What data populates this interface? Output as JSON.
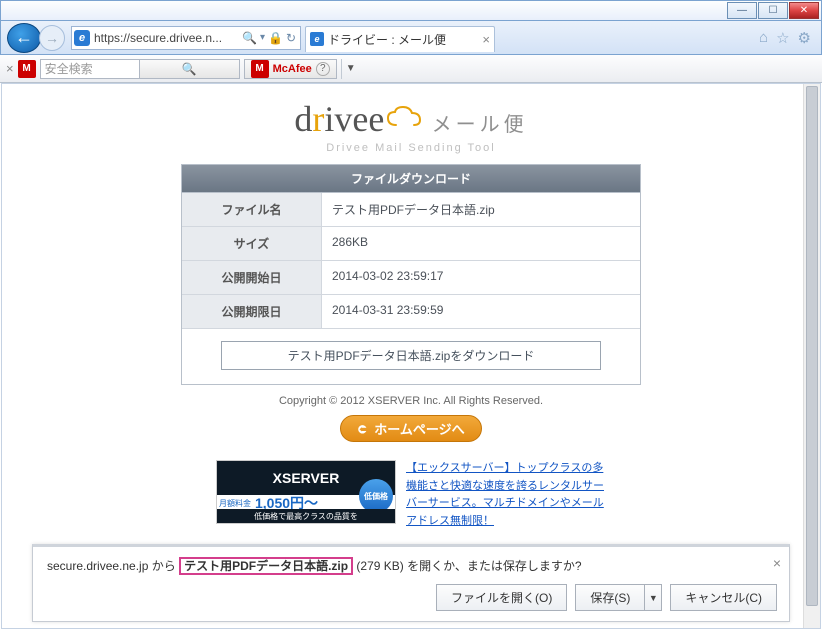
{
  "window": {
    "minimize_symbol": "—",
    "maximize_symbol": "☐",
    "close_symbol": "✕"
  },
  "browser": {
    "url": "https://secure.drivee.n...",
    "search_icon": "🔍",
    "refresh_icon": "↻",
    "lock_icon": "🔒",
    "tab_title": "ドライビー : メール便",
    "tab_close": "×",
    "home_icon": "⌂",
    "star_icon": "☆",
    "gear_icon": "⚙"
  },
  "mcafee": {
    "close": "×",
    "shield": "M",
    "search_placeholder": "安全検索",
    "brand": "McAfee",
    "help": "?",
    "dropdown": "▼"
  },
  "page": {
    "logo_main": "drivee",
    "logo_side": "メール便",
    "logo_tag": "Drivee Mail Sending Tool",
    "panel_title": "ファイルダウンロード",
    "rows": {
      "filename_k": "ファイル名",
      "filename_v": "テスト用PDFデータ日本語.zip",
      "size_k": "サイズ",
      "size_v": "286KB",
      "start_k": "公開開始日",
      "start_v": "2014-03-02 23:59:17",
      "end_k": "公開期限日",
      "end_v": "2014-03-31 23:59:59"
    },
    "download_btn": "テスト用PDFデータ日本語.zipをダウンロード",
    "copyright": "Copyright © 2012 XSERVER Inc. All Rights Reserved.",
    "home_btn": "ホームページへ",
    "ad": {
      "brand": "XSERVER",
      "tag": "低価格で最高クラスの品質を",
      "fee_label": "月額料金",
      "price": "1,050円〜",
      "badge": "低価格",
      "link_text": "【エックスサーバー】トップクラスの多機能さと快適な速度を誇るレンタルサーバーサービス。マルチドメインやメールアドレス無制限！"
    }
  },
  "notify": {
    "prefix": "secure.drivee.ne.jp から ",
    "filename": "テスト用PDFデータ日本語.zip",
    "suffix": " (279 KB) を開くか、または保存しますか?",
    "open": "ファイルを開く(O)",
    "save": "保存(S)",
    "save_arrow": "▼",
    "cancel": "キャンセル(C)",
    "close": "×"
  }
}
